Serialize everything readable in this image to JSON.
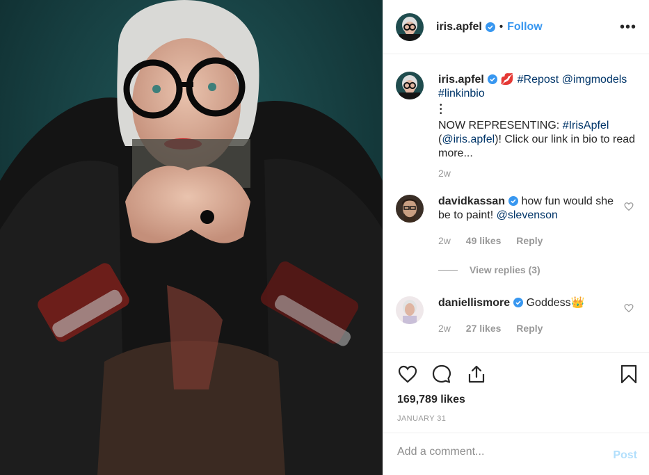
{
  "header": {
    "username": "iris.apfel",
    "separator": "•",
    "follow_label": "Follow",
    "more_label": "•••"
  },
  "caption": {
    "username": "iris.apfel",
    "emoji": "💋",
    "line1_tag": "#Repost",
    "line1_mention": "@imgmodels",
    "line2_tag": "#linkinbio",
    "dots": "•\n•\n•",
    "text_prefix": "NOW REPRESENTING: ",
    "text_tag": "#IrisApfel",
    "text_open": "(",
    "text_mention": "@iris.apfel",
    "text_rest": ")! Click our link in bio to read more...",
    "time": "2w"
  },
  "comments": [
    {
      "username": "davidkassan",
      "text": "how fun would she be to paint!",
      "mention": "@slevenson",
      "time": "2w",
      "likes": "49 likes",
      "reply": "Reply"
    },
    {
      "username": "daniellismore",
      "text": "Goddess👑",
      "time": "2w",
      "likes": "27 likes",
      "reply": "Reply"
    }
  ],
  "view_replies": "View replies (3)",
  "likes": "169,789 likes",
  "date": "JANUARY 31",
  "add_comment": {
    "placeholder": "Add a comment...",
    "post_label": "Post"
  },
  "icons": {
    "like": "heart-icon",
    "comment": "comment-icon",
    "share": "share-icon",
    "save": "bookmark-icon",
    "verified": "verified-badge-icon"
  },
  "colors": {
    "link": "#3897f0",
    "hashtag": "#003569",
    "muted": "#999999",
    "post_disabled": "#b2dffc"
  }
}
